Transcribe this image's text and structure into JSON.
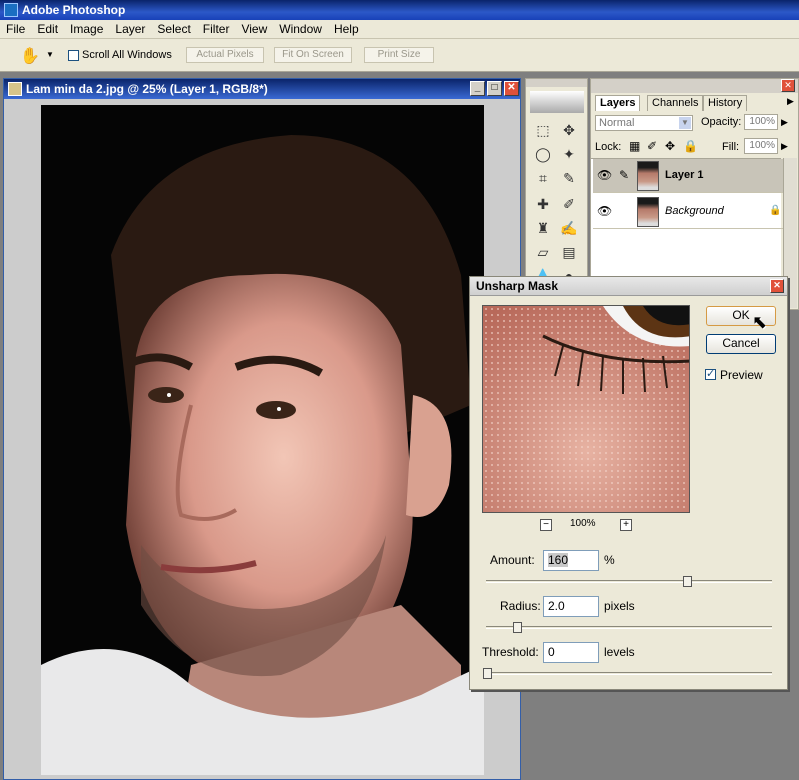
{
  "app": {
    "title": "Adobe Photoshop"
  },
  "menu": [
    "File",
    "Edit",
    "Image",
    "Layer",
    "Select",
    "Filter",
    "View",
    "Window",
    "Help"
  ],
  "options": {
    "scroll_all": "Scroll All Windows",
    "actual_pixels": "Actual Pixels",
    "fit_on_screen": "Fit On Screen",
    "print_size": "Print Size"
  },
  "document": {
    "title": "Lam min da  2.jpg @ 25% (Layer 1, RGB/8*)"
  },
  "layers_panel": {
    "tabs": [
      "Layers",
      "Channels",
      "History"
    ],
    "blend_mode": "Normal",
    "opacity_label": "Opacity:",
    "opacity": "100%",
    "lock_label": "Lock:",
    "fill_label": "Fill:",
    "fill": "100%",
    "layers": [
      {
        "name": "Layer 1"
      },
      {
        "name": "Background"
      }
    ]
  },
  "dialog": {
    "title": "Unsharp Mask",
    "ok": "OK",
    "cancel": "Cancel",
    "preview": "Preview",
    "zoom": "100%",
    "amount_label": "Amount:",
    "amount": "160",
    "amount_unit": "%",
    "radius_label": "Radius:",
    "radius": "2.0",
    "radius_unit": "pixels",
    "threshold_label": "Threshold:",
    "threshold": "0",
    "threshold_unit": "levels"
  },
  "colors": {
    "title_blue": "#0a246a",
    "dialog_bg": "#ece9d8",
    "selected_layer": "#c8c4b8"
  }
}
